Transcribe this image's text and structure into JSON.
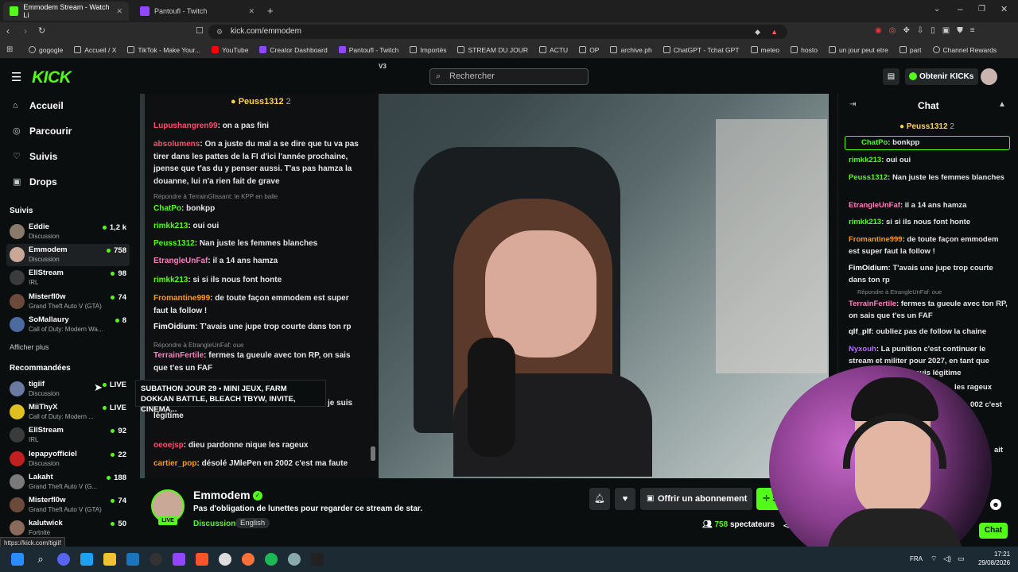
{
  "browser": {
    "tabs": [
      {
        "title": "Emmodem Stream - Watch Li",
        "color": "#53fc18",
        "active": true
      },
      {
        "title": "Pantoufl - Twitch",
        "color": "#9146ff",
        "active": false
      }
    ],
    "url": "kick.com/emmodem",
    "bookmarks": [
      "gogogle",
      "Accueil / X",
      "TikTok - Make Your...",
      "YouTube",
      "Creator Dashboard",
      "Pantoufl - Twitch",
      "Importés",
      "STREAM DU JOUR",
      "ACTU",
      "OP",
      "archive.ph",
      "ChatGPT - Tchat GPT",
      "meteo",
      "hosto",
      "un jour peut etre",
      "part",
      "Channel Rewards"
    ]
  },
  "kick": {
    "logo": "KICK",
    "search_placeholder": "Rechercher",
    "get_kicks": "Obtenir KICKs",
    "v3": "V3"
  },
  "sidebar": {
    "nav": [
      {
        "label": "Accueil",
        "icon": "home-icon"
      },
      {
        "label": "Parcourir",
        "icon": "compass-icon"
      },
      {
        "label": "Suivis",
        "icon": "heart-icon"
      },
      {
        "label": "Drops",
        "icon": "drops-icon"
      }
    ],
    "followed_title": "Suivis",
    "followed": [
      {
        "name": "Eddie",
        "category": "Discussion",
        "viewers": "1,2 k",
        "color": "#8a7a6a"
      },
      {
        "name": "Emmodem",
        "category": "Discussion",
        "viewers": "758",
        "color": "#caa898"
      },
      {
        "name": "EllStream",
        "category": "IRL",
        "viewers": "98",
        "color": "#3b3b3b"
      },
      {
        "name": "Misterfl0w",
        "category": "Grand Theft Auto V (GTA)",
        "viewers": "74",
        "color": "#6b4a3a"
      },
      {
        "name": "SoMallaury",
        "category": "Call of Duty: Modern Wa...",
        "viewers": "8",
        "color": "#4a6aa0"
      }
    ],
    "show_more": "Afficher plus",
    "recommended_title": "Recommandées",
    "recommended": [
      {
        "name": "tigiif",
        "category": "Discussion",
        "viewers": "LIVE",
        "color": "#6a7aa0"
      },
      {
        "name": "MiiThyX",
        "category": "Call of Duty: Modern ...",
        "viewers": "LIVE",
        "color": "#e0c020"
      },
      {
        "name": "EllStream",
        "category": "IRL",
        "viewers": "92",
        "color": "#3b3b3b"
      },
      {
        "name": "lepapyofficiel",
        "category": "Discussion",
        "viewers": "22",
        "color": "#c02020"
      },
      {
        "name": "Lakaht",
        "category": "Grand Theft Auto V (G...",
        "viewers": "188",
        "color": "#7a7a7a"
      },
      {
        "name": "Misterfl0w",
        "category": "Grand Theft Auto V (GTA)",
        "viewers": "74",
        "color": "#6b4a3a"
      },
      {
        "name": "kalutwick",
        "category": "Fortnite",
        "viewers": "50",
        "color": "#8a6a5a"
      }
    ]
  },
  "overlay_chat": {
    "pinned": "Peuss1312",
    "pinned_count": "2",
    "messages": [
      {
        "user": "Lupushangren99",
        "color": "#ff4d6d",
        "text": "on a pas fini"
      },
      {
        "user": "absolumens",
        "color": "#ff4d6d",
        "text": "On a juste du mal a se dire que tu va pas tirer dans les pattes de la FI d'ici l'année prochaine, jpense que t'as du y penser aussi. T'as pas hamza la douanne, lui n'a rien fait de grave"
      },
      {
        "reply": "Répondre à TerrainGlissant: le KPP en balle"
      },
      {
        "user": "ChatPo",
        "color": "#53fc18",
        "text": "bonkpp"
      },
      {
        "user": "rimkk213",
        "color": "#53fc18",
        "text": "oui oui"
      },
      {
        "user": "Peuss1312",
        "color": "#53fc18",
        "text": "Nan juste les femmes blanches"
      },
      {
        "user": "EtrangleUnFaf",
        "color": "#ff7fbf",
        "text": "il a 14 ans hamza"
      },
      {
        "user": "rimkk213",
        "color": "#53fc18",
        "text": "si si ils nous font honte"
      },
      {
        "user": "Fromantine999",
        "color": "#ff9a1a",
        "text": "de toute façon emmodem est super faut la follow !"
      },
      {
        "user": "FimOidium",
        "color": "#ffffff",
        "text": "T'avais une jupe trop courte dans ton rp"
      },
      {
        "reply": "Répondre à EtrangleUnFaf: oue"
      },
      {
        "user": "TerrainFertile",
        "color": "#ff7fbf",
        "text": "fermes ta gueule avec ton RP, on sais que t'es un FAF"
      },
      {
        "user": "",
        "color": "#ffffff",
        "text": "militer pour 2027, en tant que rebeu concerné je suis légitime"
      },
      {
        "user": "oeoejsp",
        "color": "#ff4d6d",
        "text": "dieu pardonne nique les rageux"
      },
      {
        "user": "cartier_pop",
        "color": "#ff9a1a",
        "text": "désolé JMlePen en 2002 c'est ma faute"
      }
    ]
  },
  "tooltip": "SUBATHON JOUR 29 • MINI JEUX, FARM DOKKAN BATTLE, BLEACH TBYW, INVITE, CINEMA...",
  "stream": {
    "name": "Emmodem",
    "title": "Pas d'obligation de lunettes pour regarder ce stream de star.",
    "category": "Discussion",
    "language": "English",
    "live": "LIVE",
    "subscribe": "Offrir un abonnement",
    "follow": "S",
    "viewers_count": "758",
    "viewers_label": "spectateurs"
  },
  "right_chat": {
    "title": "Chat",
    "pinned": "Peuss1312",
    "pinned_count": "2",
    "first": {
      "user": "ChatPo",
      "text": "bonkpp"
    },
    "messages": [
      {
        "user": "rimkk213",
        "color": "#53fc18",
        "text": "oui oui"
      },
      {
        "user": "Peuss1312",
        "color": "#53fc18",
        "text": "Nan juste les femmes blanches"
      },
      {
        "user": "EtrangleUnFaf",
        "color": "#ff7fbf",
        "text": "il a 14 ans hamza"
      },
      {
        "user": "rimkk213",
        "color": "#53fc18",
        "text": "si si ils nous font honte"
      },
      {
        "user": "Fromantine999",
        "color": "#ff9a1a",
        "text": "de toute façon emmodem est super faut la follow !"
      },
      {
        "user": "FimOidium",
        "color": "#ffffff",
        "text": "T'avais une jupe trop courte dans ton rp"
      },
      {
        "reply": "Répondre à EtrangleUnFaf: oue"
      },
      {
        "user": "TerrainFertile",
        "color": "#ff7fbf",
        "text": "fermes ta gueule avec ton RP, on sais que t'es un FAF"
      },
      {
        "user": "qlf_plf",
        "color": "#ffffff",
        "text": "oubliez pas de follow la chaine"
      },
      {
        "user": "Nyxouh",
        "color": "#b36bff",
        "text": "La punition c'est continuer le stream et militer pour 2027, en tant que rebeu concerné je suis légitime"
      }
    ],
    "partial_1": "les rageux",
    "partial_2": "002 c'est",
    "partial_3": "ait",
    "chat_button": "Chat"
  },
  "status_url": "https://kick.com/tigiif",
  "taskbar": {
    "lang": "FRA",
    "time": "17:21",
    "date": "29/08/2026"
  }
}
